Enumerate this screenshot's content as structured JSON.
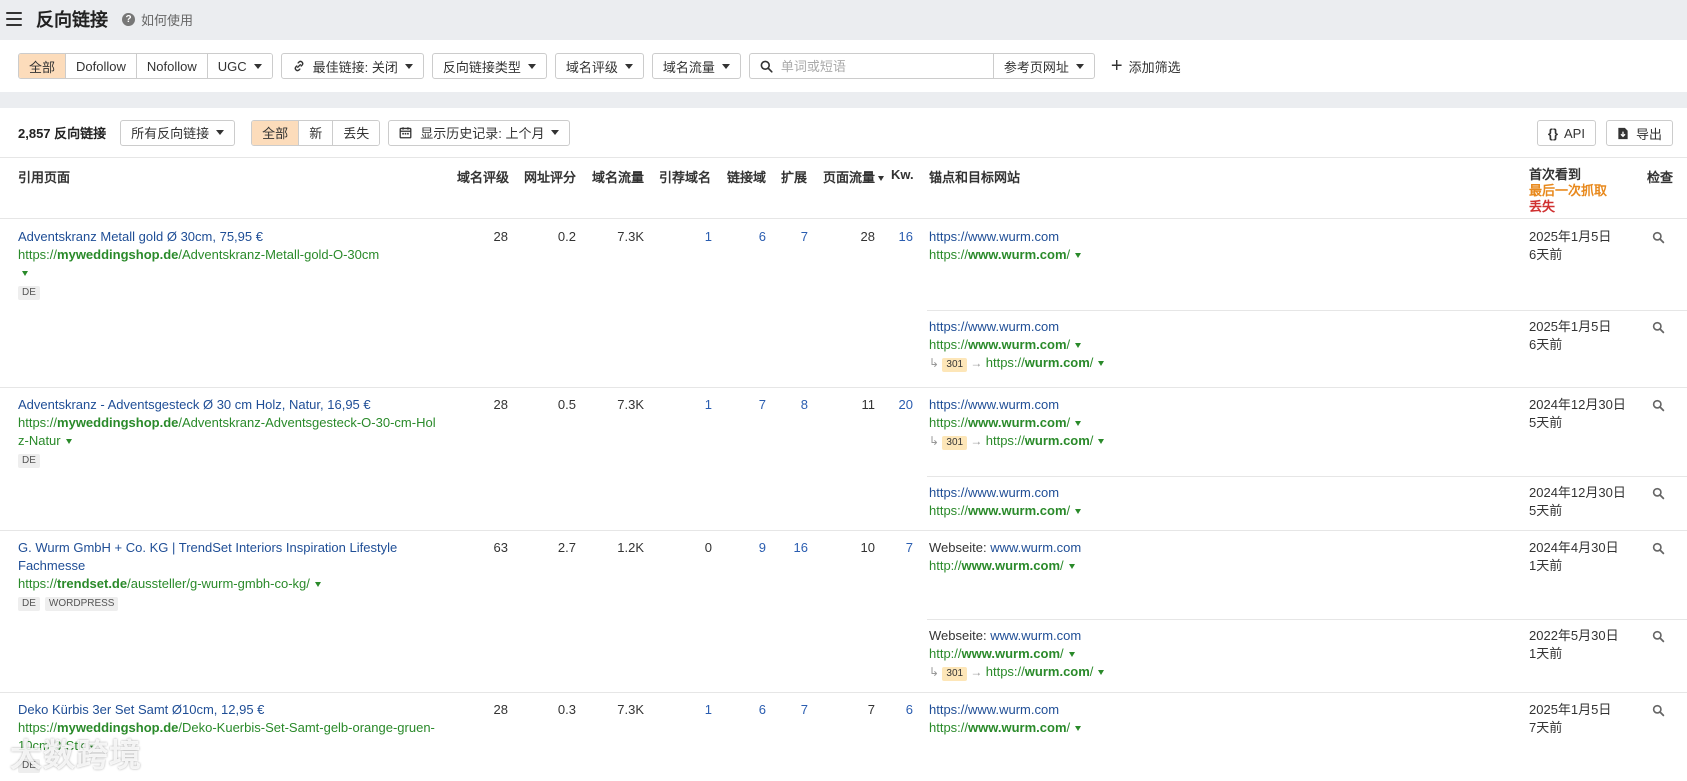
{
  "header": {
    "title": "反向链接",
    "help": "如何使用"
  },
  "filters": {
    "type_tabs": [
      "全部",
      "Dofollow",
      "Nofollow",
      "UGC"
    ],
    "best_links": "最佳链接: 关闭",
    "link_type": "反向链接类型",
    "dr": "域名评级",
    "domain_traffic": "域名流量",
    "search_placeholder": "单词或短语",
    "search_scope": "参考页网址",
    "add_filter": "添加筛选"
  },
  "results": {
    "count": "2,857 反向链接",
    "all_backlinks": "所有反向链接",
    "status_tabs": [
      "全部",
      "新",
      "丢失"
    ],
    "history": "显示历史记录: 上个月",
    "api": "API",
    "export": "导出"
  },
  "columns": {
    "ref_page": "引用页面",
    "dr": "域名评级",
    "ur": "网址评分",
    "domain_traffic": "域名流量",
    "ref_domains": "引荐域名",
    "linked_domains": "链接域",
    "ext": "扩展",
    "page_traffic": "页面流量",
    "kw": "Kw.",
    "anchor": "锚点和目标网站",
    "first_seen": "首次看到",
    "last_crawled": "最后一次抓取",
    "lost": "丢失",
    "inspect": "检查"
  },
  "rows": [
    {
      "title": "Adventskranz Metall gold Ø 30cm, 75,95 €",
      "url_prefix": "https://",
      "url_domain": "myweddingshop.de",
      "url_path": "/Adventskranz-Metall-gold-O-30cm",
      "tags": [
        "DE"
      ],
      "dr": "28",
      "ur": "0.2",
      "traffic": "7.3K",
      "ref_domains": "1",
      "linked": "6",
      "ext": "7",
      "page_traffic": "28",
      "kw": "16",
      "links": [
        {
          "anchor": "https://www.wurm.com",
          "target_prefix": "https://",
          "target_domain": "www.wurm.com",
          "target_path": "/",
          "date": "2025年1月5日",
          "ago": "6天前"
        },
        {
          "anchor": "https://www.wurm.com",
          "target_prefix": "https://",
          "target_domain": "www.wurm.com",
          "target_path": "/",
          "redirect_code": "301",
          "redirect_prefix": "https://",
          "redirect_domain": "wurm.com",
          "redirect_path": "/",
          "date": "2025年1月5日",
          "ago": "6天前"
        }
      ]
    },
    {
      "title": "Adventskranz - Adventsgesteck Ø 30 cm Holz, Natur, 16,95 €",
      "url_prefix": "https://",
      "url_domain": "myweddingshop.de",
      "url_path": "/Adventskranz-Adventsgesteck-O-30-cm-Holz-Natur",
      "tags": [
        "DE"
      ],
      "dr": "28",
      "ur": "0.5",
      "traffic": "7.3K",
      "ref_domains": "1",
      "linked": "7",
      "ext": "8",
      "page_traffic": "11",
      "kw": "20",
      "links": [
        {
          "anchor": "https://www.wurm.com",
          "target_prefix": "https://",
          "target_domain": "www.wurm.com",
          "target_path": "/",
          "redirect_code": "301",
          "redirect_prefix": "https://",
          "redirect_domain": "wurm.com",
          "redirect_path": "/",
          "date": "2024年12月30日",
          "ago": "5天前"
        },
        {
          "anchor": "https://www.wurm.com",
          "target_prefix": "https://",
          "target_domain": "www.wurm.com",
          "target_path": "/",
          "date": "2024年12月30日",
          "ago": "5天前"
        }
      ]
    },
    {
      "title": "G. Wurm GmbH + Co. KG | TrendSet Interiors Inspiration Lifestyle Fachmesse",
      "url_prefix": "https://",
      "url_domain": "trendset.de",
      "url_path": "/aussteller/g-wurm-gmbh-co-kg/",
      "tags": [
        "DE",
        "WORDPRESS"
      ],
      "dr": "63",
      "ur": "2.7",
      "traffic": "1.2K",
      "ref_domains": "0",
      "linked": "9",
      "ext": "16",
      "page_traffic": "10",
      "kw": "7",
      "links": [
        {
          "anchor_prefix": "Webseite: ",
          "anchor": "www.wurm.com",
          "target_prefix": "http://",
          "target_domain": "www.wurm.com",
          "target_path": "/",
          "date": "2024年4月30日",
          "ago": "1天前"
        },
        {
          "anchor_prefix": "Webseite: ",
          "anchor": "www.wurm.com",
          "target_prefix": "http://",
          "target_domain": "www.wurm.com",
          "target_path": "/",
          "redirect_code": "301",
          "redirect_prefix": "https://",
          "redirect_domain": "wurm.com",
          "redirect_path": "/",
          "date": "2022年5月30日",
          "ago": "1天前"
        }
      ]
    },
    {
      "title": "Deko Kürbis 3er Set Samt Ø10cm, 12,95 €",
      "url_prefix": "https://",
      "url_domain": "myweddingshop.de",
      "url_path": "/Deko-Kuerbis-Set-Samt-gelb-orange-gruen-10cm-3-Stk",
      "tags": [
        "DE"
      ],
      "dr": "28",
      "ur": "0.3",
      "traffic": "7.3K",
      "ref_domains": "1",
      "linked": "6",
      "ext": "7",
      "page_traffic": "7",
      "kw": "6",
      "links": [
        {
          "anchor": "https://www.wurm.com",
          "target_prefix": "https://",
          "target_domain": "www.wurm.com",
          "target_path": "/",
          "date": "2025年1月5日",
          "ago": "7天前"
        }
      ]
    }
  ],
  "watermark": "大数跨境"
}
